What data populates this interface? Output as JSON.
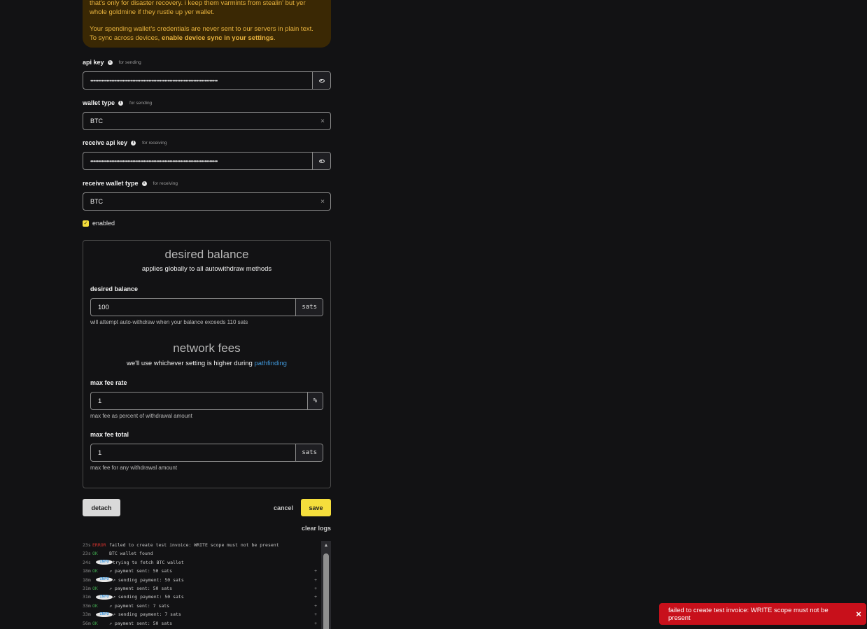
{
  "banner": {
    "line1": "that's only for disaster recovery. i keep them varmints from stealin' but yer",
    "line2": "whole goldmine if they rustle up yer wallet.",
    "line3": "Your spending wallet's credentials are never sent to our servers in plain text.",
    "line4_prefix": "To sync across devices, ",
    "line4_link": "enable device sync in your settings",
    "line4_suffix": "."
  },
  "fields": {
    "api_key": {
      "label": "api key",
      "hint": "for sending",
      "value": "•••••••••••••••••••••••••••••••••••••••••••••••••••••••••••••••••••••••••••••••"
    },
    "wallet_type": {
      "label": "wallet type",
      "hint": "for sending",
      "value": "BTC",
      "clear": "×"
    },
    "receive_api_key": {
      "label": "receive api key",
      "hint": "for receiving",
      "value": "•••••••••••••••••••••••••••••••••••••••••••••••••••••••••••••••••••••••••••••••"
    },
    "receive_wallet_type": {
      "label": "receive wallet type",
      "hint": "for receiving",
      "value": "BTC",
      "clear": "×"
    }
  },
  "enabled": {
    "label": "enabled",
    "checked": true
  },
  "panel": {
    "desired_title": "desired balance",
    "desired_sub": "applies globally to all autowithdraw methods",
    "desired_label": "desired balance",
    "desired_value": "100",
    "desired_unit": "sats",
    "desired_help": "will attempt auto-withdraw when your balance exceeds 110 sats",
    "fees_title": "network fees",
    "fees_sub_prefix": "we'll use whichever setting is higher during ",
    "fees_sub_link": "pathfinding",
    "fee_rate_label": "max fee rate",
    "fee_rate_value": "1",
    "fee_rate_unit": "%",
    "fee_rate_help": "max fee as percent of withdrawal amount",
    "fee_total_label": "max fee total",
    "fee_total_value": "1",
    "fee_total_unit": "sats",
    "fee_total_help": "max fee for any withdrawal amount"
  },
  "actions": {
    "detach": "detach",
    "cancel": "cancel",
    "save": "save",
    "clear_logs": "clear logs"
  },
  "logs": [
    {
      "time": "23s",
      "level": "ERROR",
      "msg": "failed to create test invoice: WRITE scope must not be present",
      "plus": ""
    },
    {
      "time": "23s",
      "level": "OK",
      "msg": "BTC wallet found",
      "plus": ""
    },
    {
      "time": "24s",
      "level": "INFO",
      "msg": "trying to fetch BTC wallet",
      "plus": ""
    },
    {
      "time": "18m",
      "level": "OK",
      "msg": "↗ payment sent: 50 sats",
      "plus": "+"
    },
    {
      "time": "18m",
      "level": "INFO",
      "msg": "↗ sending payment: 50 sats",
      "plus": "+"
    },
    {
      "time": "31m",
      "level": "OK",
      "msg": "↗ payment sent: 50 sats",
      "plus": "+"
    },
    {
      "time": "31m",
      "level": "INFO",
      "msg": "↗ sending payment: 50 sats",
      "plus": "+"
    },
    {
      "time": "33m",
      "level": "OK",
      "msg": "↗ payment sent: 7 sats",
      "plus": "+"
    },
    {
      "time": "33m",
      "level": "INFO",
      "msg": "↗ sending payment: 7 sats",
      "plus": "+"
    },
    {
      "time": "56m",
      "level": "OK",
      "msg": "↗ payment sent: 50 sats",
      "plus": "+"
    }
  ],
  "toast": {
    "message": "failed to create test invoice: WRITE scope must not be present",
    "close": "×"
  },
  "colors": {
    "accent": "#f5de3c",
    "error": "#c8101b",
    "ok": "#3fa34d",
    "info": "#3f96d9",
    "link": "#3f96d9"
  }
}
